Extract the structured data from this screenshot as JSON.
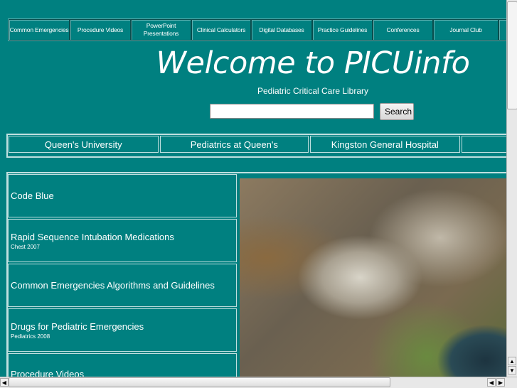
{
  "top_nav": [
    "Common Emergencies",
    "Procedure Videos",
    "PowerPoint Presentations",
    "Clinical Calculators",
    "Digital Databases",
    "Practice Guidelines",
    "Conferences",
    "Journal Club",
    ""
  ],
  "title": "Welcome to PICUinfo",
  "subtitle": "Pediatric Critical Care Library",
  "search": {
    "value": "",
    "button": "Search"
  },
  "links_nav": [
    "Queen's University",
    "Pediatrics at Queen's",
    "Kingston General Hospital",
    ""
  ],
  "items": [
    {
      "label": "Code Blue",
      "source": ""
    },
    {
      "label": "Rapid Sequence Intubation Medications",
      "source": "Chest 2007"
    },
    {
      "label": "Common Emergencies Algorithms and Guidelines",
      "source": ""
    },
    {
      "label": "Drugs for Pediatric Emergencies",
      "source": "Pediatrics 2008"
    },
    {
      "label": "Procedure Videos",
      "source": ""
    }
  ]
}
